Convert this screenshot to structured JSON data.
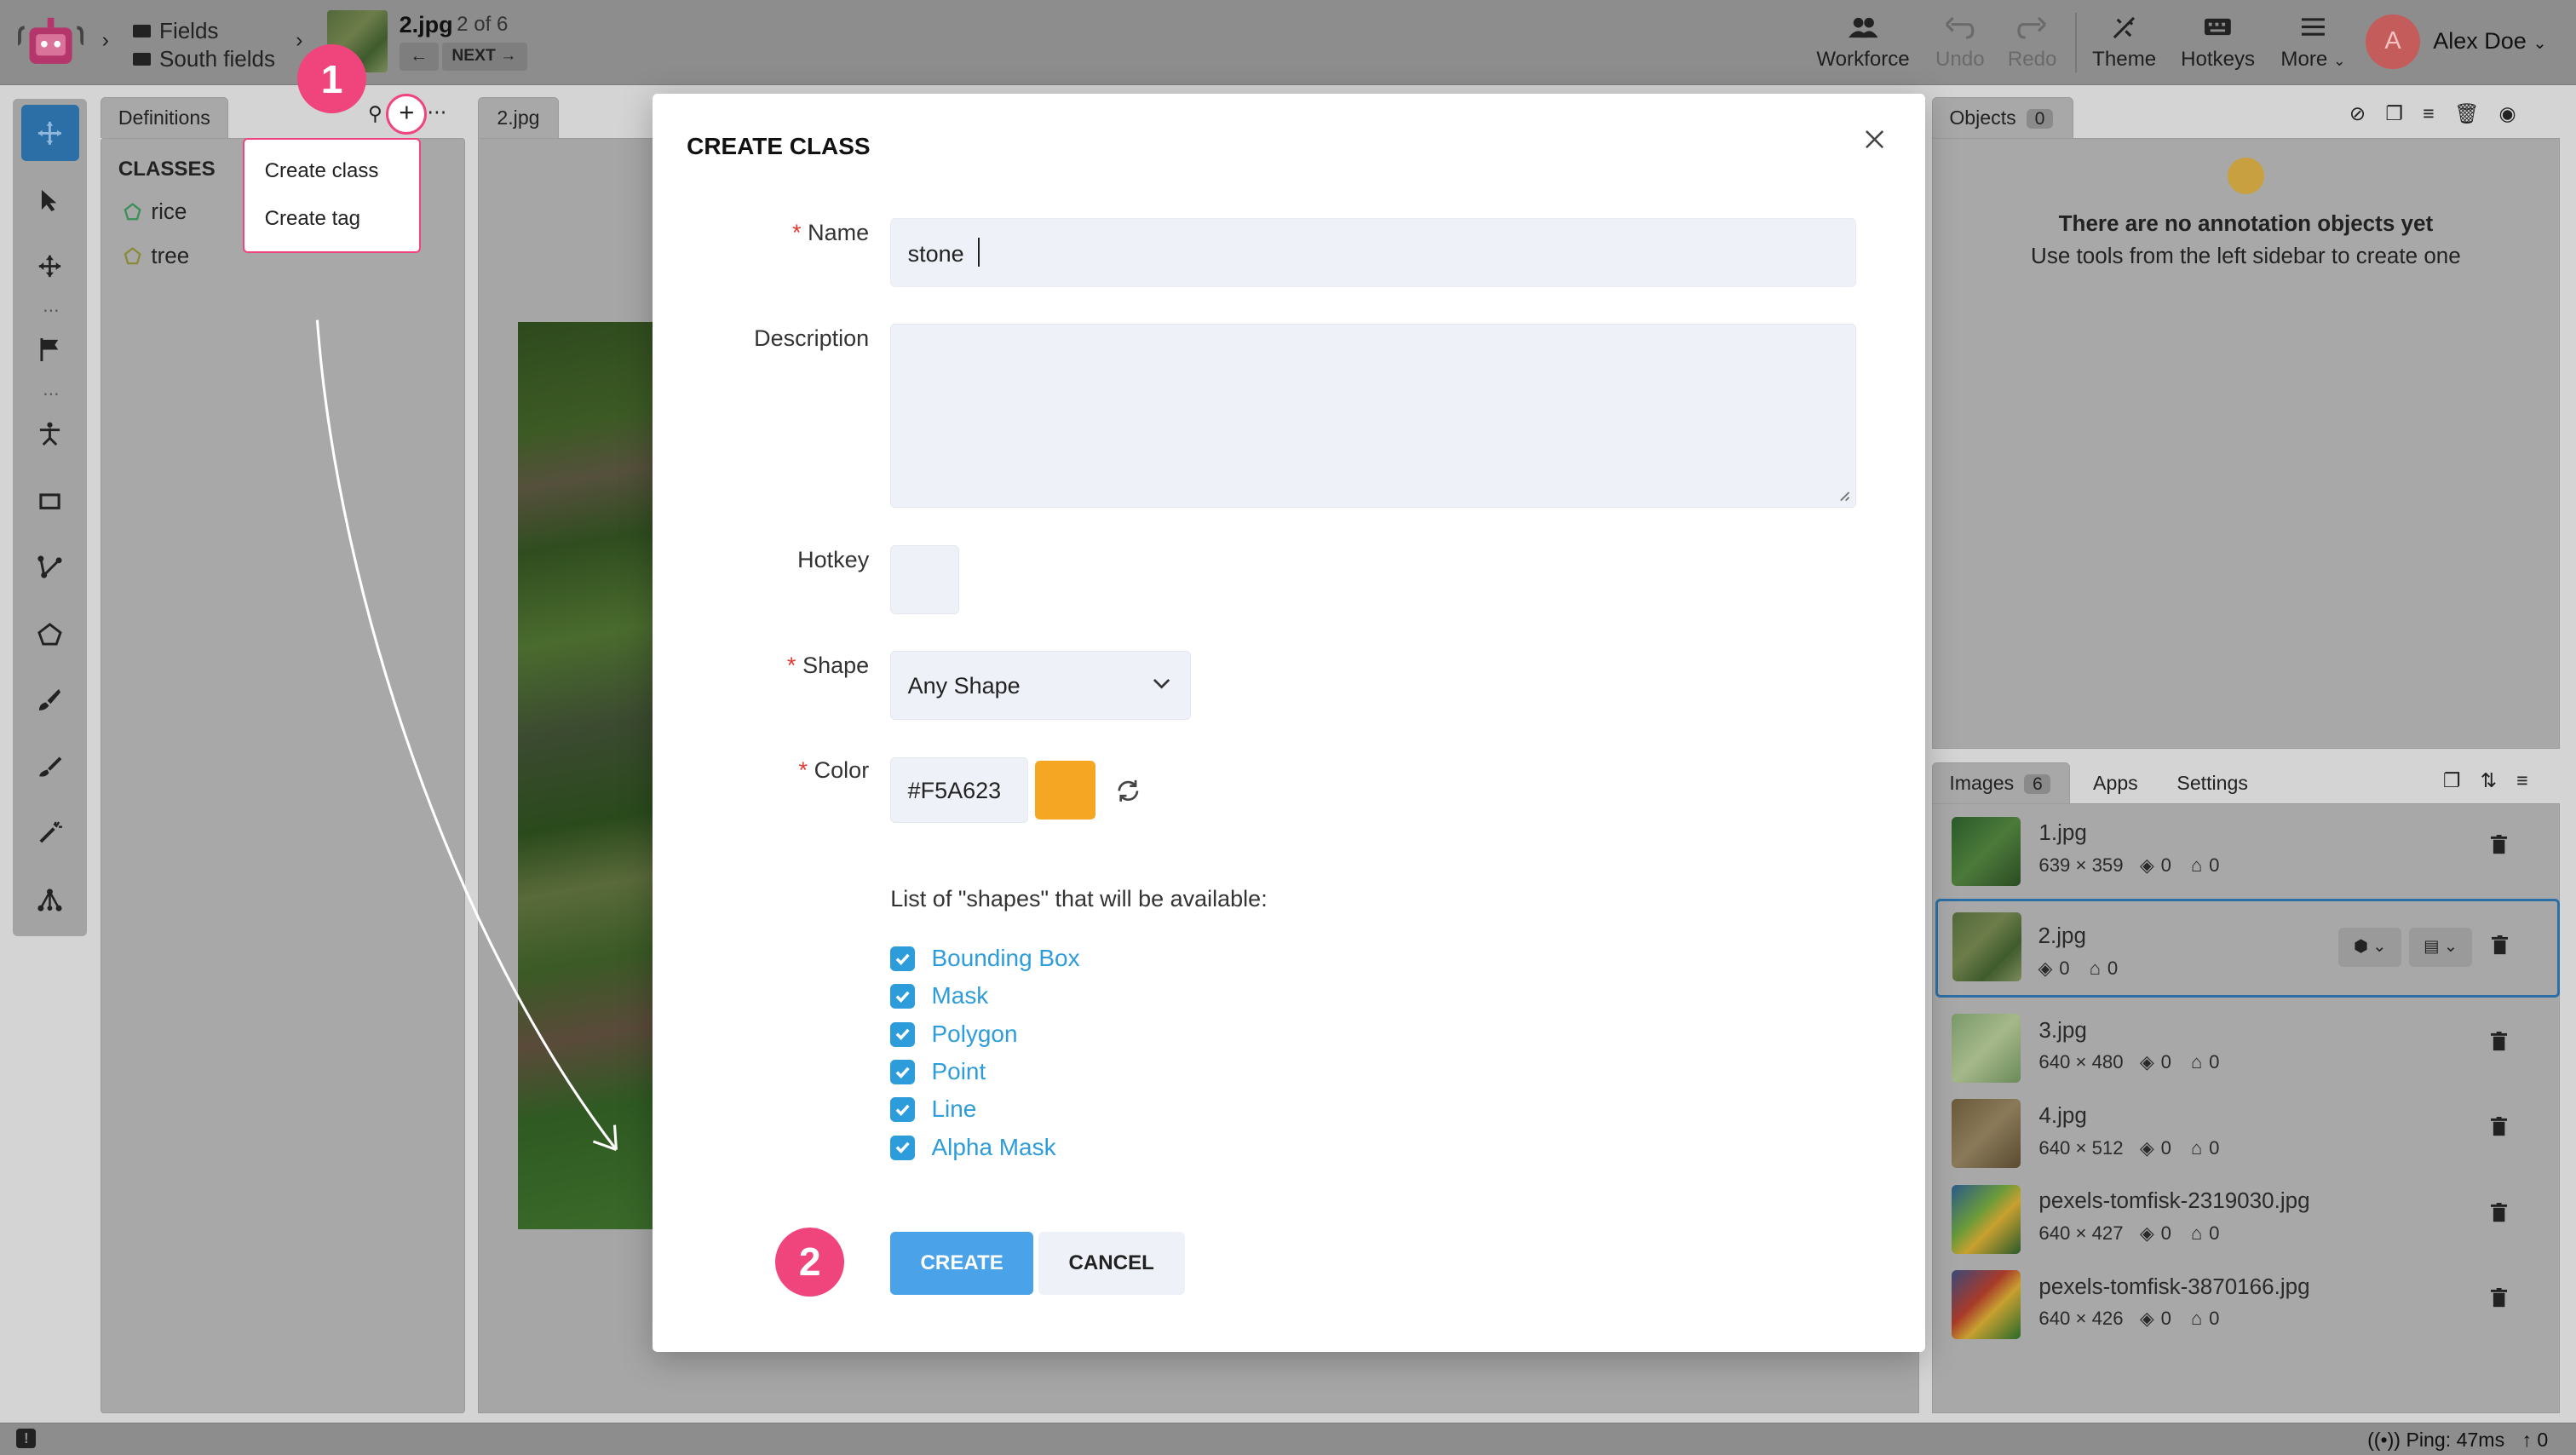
{
  "app": {
    "logo": "robot-logo-icon"
  },
  "breadcrumb": {
    "project": "Fields",
    "dataset": "South fields"
  },
  "image_nav": {
    "filename": "2.jpg",
    "position": "2 of 6",
    "next_label": "NEXT"
  },
  "toolbar": {
    "workforce": "Workforce",
    "undo": "Undo",
    "redo": "Redo",
    "theme": "Theme",
    "hotkeys": "Hotkeys",
    "more": "More"
  },
  "user": {
    "initial": "A",
    "name": "Alex Doe",
    "avatar_color": "#e57373"
  },
  "left_panel": {
    "tab": "Definitions",
    "classes_heading": "CLASSES",
    "classes": [
      {
        "name": "rice"
      },
      {
        "name": "tree"
      }
    ],
    "add_menu": [
      "Create class",
      "Create tag"
    ]
  },
  "canvas_tab": "2.jpg",
  "modal": {
    "title": "CREATE CLASS",
    "name_label": "Name",
    "name_value": "stone",
    "description_label": "Description",
    "description_value": "",
    "hotkey_label": "Hotkey",
    "hotkey_value": "",
    "shape_label": "Shape",
    "shape_value": "Any Shape",
    "color_label": "Color",
    "color_value": "#F5A623",
    "shapes_intro": "List of \"shapes\" that will be available:",
    "shapes": [
      "Bounding Box",
      "Mask",
      "Polygon",
      "Point",
      "Line",
      "Alpha Mask"
    ],
    "create_label": "CREATE",
    "cancel_label": "CANCEL"
  },
  "annotations": {
    "step1": "1",
    "step2": "2"
  },
  "objects_panel": {
    "tab": "Objects",
    "count": "0",
    "empty_icon": "sleepy-face-icon",
    "empty_title": "There are no annotation objects yet",
    "empty_hint": "Use tools from the left sidebar to create one"
  },
  "images_panel": {
    "tabs": [
      "Images",
      "Apps",
      "Settings"
    ],
    "count": "6",
    "images": [
      {
        "name": "1.jpg",
        "size": "639 × 359",
        "objects": "0",
        "tags": "0"
      },
      {
        "name": "2.jpg",
        "size": "",
        "objects": "0",
        "tags": "0"
      },
      {
        "name": "3.jpg",
        "size": "640 × 480",
        "objects": "0",
        "tags": "0"
      },
      {
        "name": "4.jpg",
        "size": "640 × 512",
        "objects": "0",
        "tags": "0"
      },
      {
        "name": "pexels-tomfisk-2319030.jpg",
        "size": "640 × 427",
        "objects": "0",
        "tags": "0"
      },
      {
        "name": "pexels-tomfisk-3870166.jpg",
        "size": "640 × 426",
        "objects": "0",
        "tags": "0"
      }
    ]
  },
  "status": {
    "ping": "Ping: 47ms",
    "uploads": "0"
  }
}
